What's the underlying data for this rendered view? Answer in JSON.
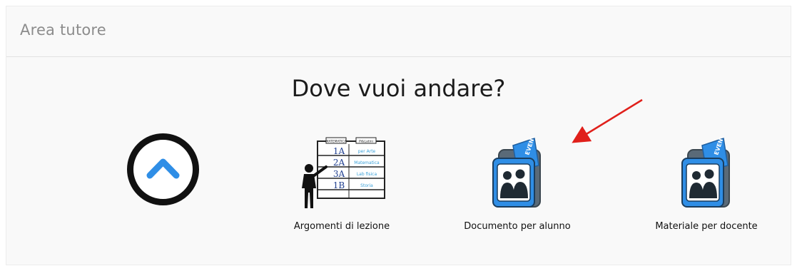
{
  "panel": {
    "title": "Area tutore"
  },
  "main": {
    "heading": "Dove vuoi andare?"
  },
  "tiles": [
    {
      "label": "Argomenti di lezione",
      "icon": "classroom-schedule-icon"
    },
    {
      "label": "Documento per alunno",
      "icon": "student-event-badge-icon"
    },
    {
      "label": "Materiale per docente",
      "icon": "teacher-event-badge-icon"
    }
  ],
  "schedule_board": {
    "header_left": "MATEMATICA",
    "header_right": "Pi&Latini",
    "rows": [
      {
        "class": "1A",
        "subject": "per Arte"
      },
      {
        "class": "2A",
        "subject": "Matematica"
      },
      {
        "class": "3A",
        "subject": "Lab fisica"
      },
      {
        "class": "1B",
        "subject": "Storia"
      }
    ]
  },
  "badge_text": "EVENT",
  "colors": {
    "accent_blue": "#2f8ee6",
    "icon_dark": "#1f4e79",
    "annotation_red": "#e0201b"
  }
}
